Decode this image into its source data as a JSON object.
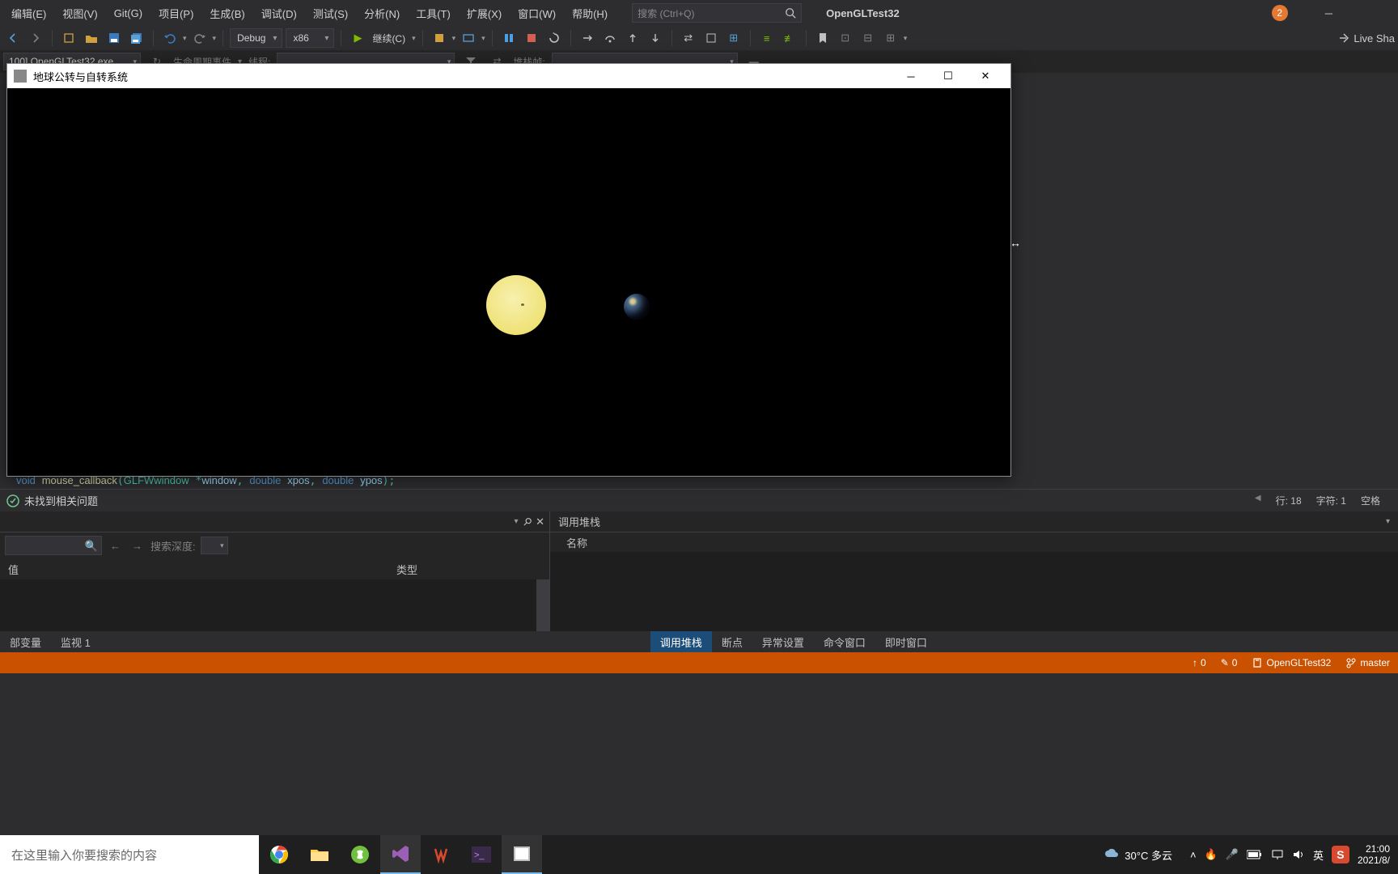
{
  "menu": {
    "edit": "编辑(E)",
    "view": "视图(V)",
    "git": "Git(G)",
    "project": "项目(P)",
    "build": "生成(B)",
    "debug": "调试(D)",
    "test": "测试(S)",
    "analyze": "分析(N)",
    "tools": "工具(T)",
    "extensions": "扩展(X)",
    "window": "窗口(W)",
    "help": "帮助(H)"
  },
  "search_placeholder": "搜索 (Ctrl+Q)",
  "project_name": "OpenGLTest32",
  "badge_count": "2",
  "toolbar": {
    "config": "Debug",
    "platform": "x86",
    "continue": "继续(C)"
  },
  "liveshare": "Live Sha",
  "second_toolbar": {
    "process": "100] OpenGLTest32.exe",
    "lifecycle": "生命周期事件",
    "thread": "线程:",
    "stackframe": "堆栈帧:"
  },
  "gl_window": {
    "title": "地球公转与自转系统"
  },
  "code_line": "void mouse_callback(GLFWwindow *window, double xpos, double ypos);",
  "status": {
    "no_issues": "未找到相关问题",
    "line": "行: 18",
    "char": "字符: 1",
    "space": "空格"
  },
  "panel_left": {
    "search_depth": "搜索深度:",
    "col_value": "值",
    "col_type": "类型",
    "tab_locals": "部变量",
    "tab_watch": "监视 1"
  },
  "panel_right": {
    "title": "调用堆栈",
    "col_name": "名称",
    "tab_callstack": "调用堆栈",
    "tab_breakpoints": "断点",
    "tab_exception": "异常设置",
    "tab_command": "命令窗口",
    "tab_immediate": "即时窗口"
  },
  "orange": {
    "up": "0",
    "down": "0",
    "project": "OpenGLTest32",
    "branch": "master"
  },
  "taskbar": {
    "search_placeholder": "在这里输入你要搜索的内容",
    "weather": "30°C 多云",
    "ime": "英",
    "time": "21:00",
    "date": "2021/8/"
  }
}
